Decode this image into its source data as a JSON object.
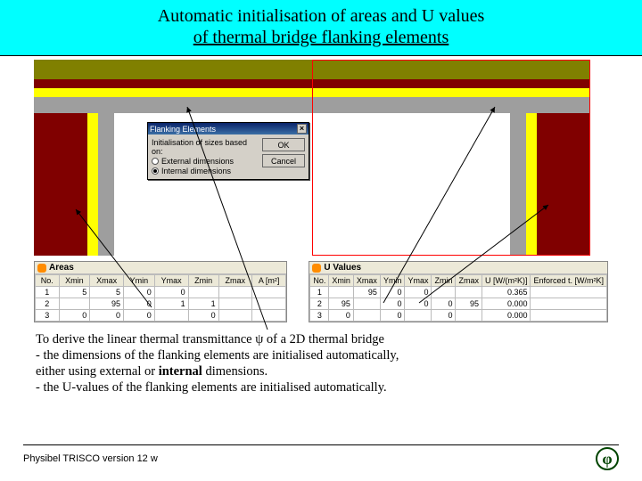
{
  "title": {
    "line1": "Automatic initialisation of areas and U values",
    "line2": "of thermal bridge flanking elements"
  },
  "dialog": {
    "title": "Flanking Elements",
    "group": "Initialisation of sizes based on:",
    "opt_external": "External dimensions",
    "opt_internal": "Internal dimensions",
    "ok": "OK",
    "cancel": "Cancel"
  },
  "areas_panel": {
    "caption": "Areas",
    "headers": [
      "No.",
      "Xmin",
      "Xmax",
      "Ymin",
      "Ymax",
      "Zmin",
      "Zmax",
      "A [m²]"
    ],
    "rows": [
      [
        "1",
        "5",
        "5",
        "0",
        "0",
        "",
        "",
        ""
      ],
      [
        "2",
        "",
        "95",
        "0",
        "1",
        "1",
        "",
        ""
      ],
      [
        "3",
        "0",
        "0",
        "0",
        "",
        "0",
        "",
        ""
      ]
    ]
  },
  "uvalues_panel": {
    "caption": "U Values",
    "headers": [
      "No.",
      "Xmin",
      "Xmax",
      "Ymin",
      "Ymax",
      "Zmin",
      "Zmax",
      "U [W/(m²K)]",
      "Enforced t. [W/m²K]"
    ],
    "rows": [
      [
        "1",
        "",
        "95",
        "0",
        "0",
        "",
        "",
        "0.365",
        ""
      ],
      [
        "2",
        "95",
        "",
        "0",
        "0",
        "0",
        "95",
        "0.000",
        ""
      ],
      [
        "3",
        "0",
        "",
        "0",
        "",
        "0",
        "",
        "0.000",
        ""
      ]
    ]
  },
  "notes": {
    "l1a": "To derive the linear thermal transmittance ",
    "l1b": " of a 2D thermal bridge",
    "psi": "ψ",
    "l2": "- the dimensions of the flanking elements are initialised automatically,",
    "l3_pre": "  either using external or ",
    "l3_bold": "internal",
    "l3_post": " dimensions.",
    "l4": "- the U-values of the flanking elements are initialised automatically."
  },
  "footer": {
    "text": "Physibel TRISCO version 12 w",
    "logo": "φ"
  }
}
